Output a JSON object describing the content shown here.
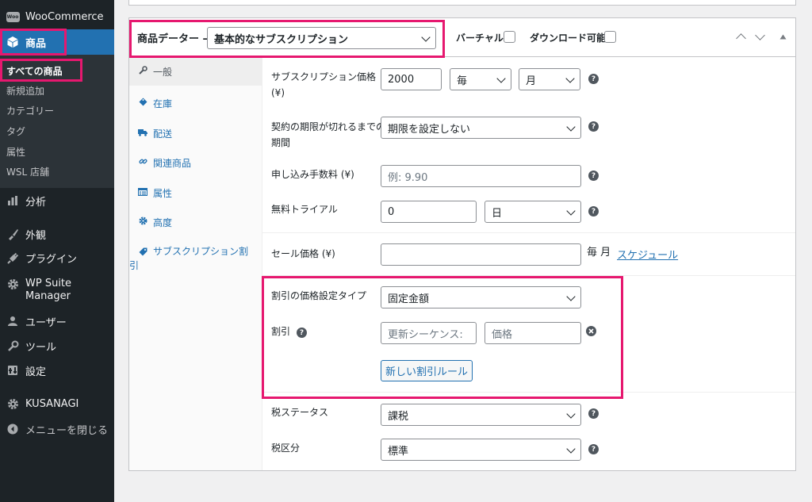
{
  "sidebar": {
    "woocommerce": "WooCommerce",
    "products": "商品",
    "submenu": [
      "すべての商品",
      "新規追加",
      "カテゴリー",
      "タグ",
      "属性",
      "WSL 店舗"
    ],
    "analytics": "分析",
    "appearance": "外観",
    "plugins": "プラグイン",
    "wpsuite_line1": "WP Suite",
    "wpsuite_line2": "Manager",
    "users": "ユーザー",
    "tools": "ツール",
    "settings": "設定",
    "kusanagi": "KUSANAGI",
    "collapse": "メニューを閉じる",
    "woo_badge": "Woo"
  },
  "header": {
    "label": "商品データー —",
    "product_type": "基本的なサブスクリプション",
    "virtual_label": "バーチャル:",
    "download_label": "ダウンロード可能:"
  },
  "tabs": [
    {
      "label": "一般",
      "icon": "wrench-icon"
    },
    {
      "label": "在庫",
      "icon": "tag-icon"
    },
    {
      "label": "配送",
      "icon": "truck-icon"
    },
    {
      "label": "関連商品",
      "icon": "link-icon"
    },
    {
      "label": "属性",
      "icon": "table-icon"
    },
    {
      "label": "高度",
      "icon": "gear-icon"
    },
    {
      "label_line1": "サブスクリプション割",
      "label_line2": "引",
      "icon": "price-tag-icon"
    }
  ],
  "fields": {
    "price_label_line1": "サブスクリプション価格",
    "price_label_line2": "(¥)",
    "price_value": "2000",
    "interval_value": "毎",
    "period_value": "月",
    "length_label_line1": "契約の期限が切れるまでの",
    "length_label_line2": "期間",
    "length_value": "期限を設定しない",
    "signup_label": "申し込み手数料 (¥)",
    "signup_placeholder": "例: 9.90",
    "trial_label": "無料トライアル",
    "trial_value": "0",
    "trial_unit": "日",
    "sale_label": "セール価格 (¥)",
    "sale_value": "",
    "sale_period": "毎 月",
    "schedule_link": "スケジュール",
    "discount_type_label": "割引の価格設定タイプ",
    "discount_type_value": "固定金額",
    "discount_label": "割引",
    "renewal_placeholder": "更新シーケンス:",
    "discount_price_placeholder": "価格",
    "new_rule_button": "新しい割引ルール",
    "tax_status_label": "税ステータス",
    "tax_status_value": "課税",
    "tax_class_label": "税区分",
    "tax_class_value": "標準",
    "help_glyph": "?"
  },
  "colors": {
    "highlight": "#e6186f",
    "admin_bg": "#1d2327",
    "accent": "#2271b1"
  }
}
